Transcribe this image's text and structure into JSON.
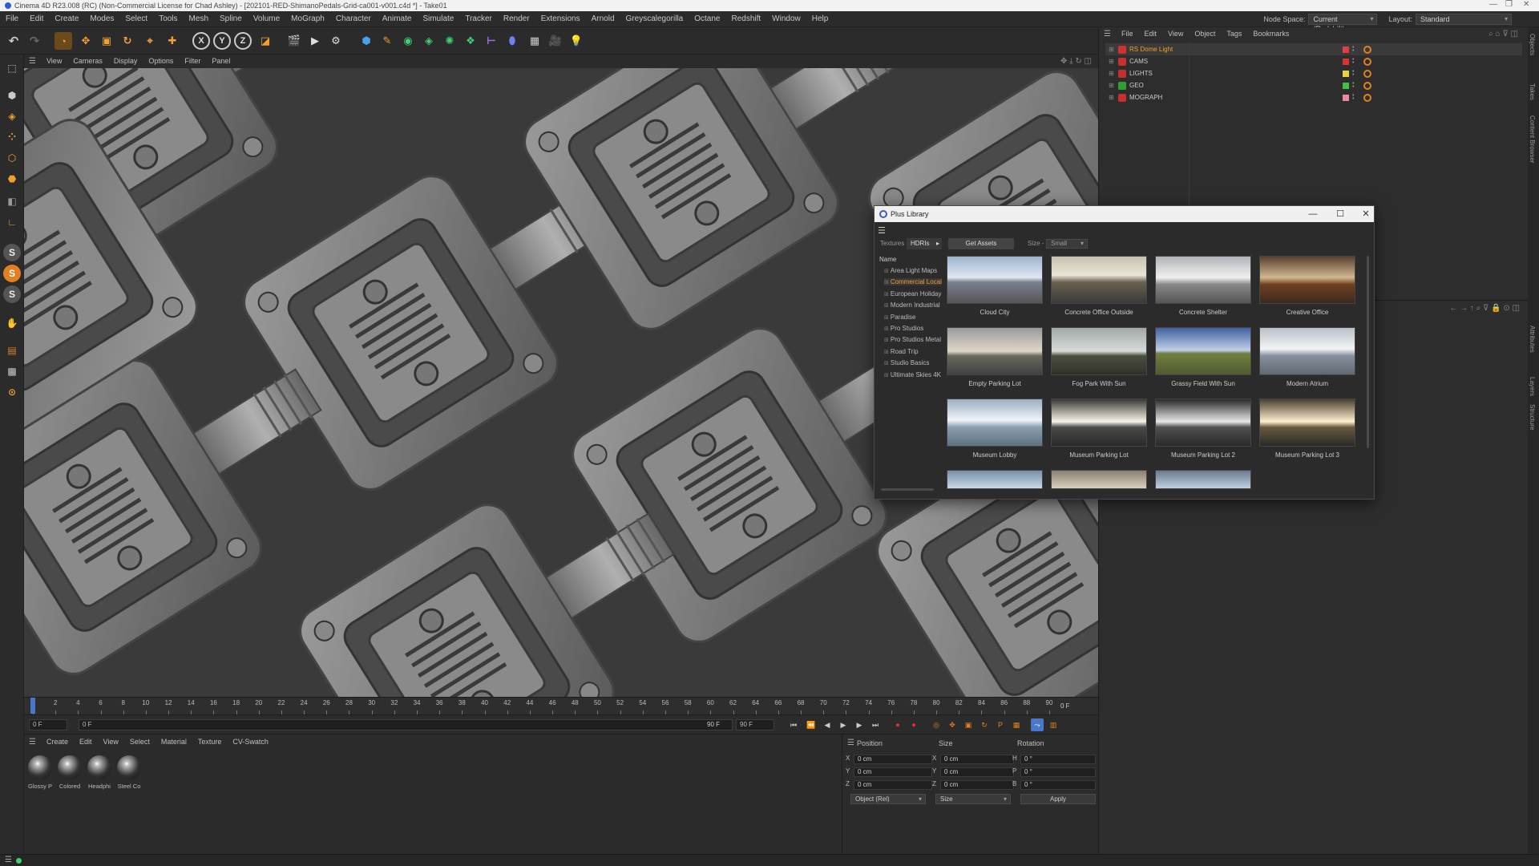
{
  "window_title": "Cinema 4D R23.008 (RC) (Non-Commercial License for Chad Ashley) - [202101-RED-ShimanoPedals-Grid-ca001-v001.c4d *] - Take01",
  "menu": [
    "File",
    "Edit",
    "Create",
    "Modes",
    "Select",
    "Tools",
    "Mesh",
    "Spline",
    "Volume",
    "MoGraph",
    "Character",
    "Animate",
    "Simulate",
    "Tracker",
    "Render",
    "Extensions",
    "Arnold",
    "Greyscalegorilla",
    "Octane",
    "Redshift",
    "Window",
    "Help"
  ],
  "node_space_label": "Node Space:",
  "node_space_value": "Current (Redshift)",
  "layout_label": "Layout:",
  "layout_value": "Standard",
  "viewport_menu": [
    "View",
    "Cameras",
    "Display",
    "Options",
    "Filter",
    "Panel"
  ],
  "timeline": {
    "ticks": [
      "0",
      "2",
      "4",
      "6",
      "8",
      "10",
      "12",
      "14",
      "16",
      "18",
      "20",
      "22",
      "24",
      "26",
      "28",
      "30",
      "32",
      "34",
      "36",
      "38",
      "40",
      "42",
      "44",
      "46",
      "48",
      "50",
      "52",
      "54",
      "56",
      "58",
      "60",
      "62",
      "64",
      "66",
      "68",
      "70",
      "72",
      "74",
      "76",
      "78",
      "80",
      "82",
      "84",
      "86",
      "88",
      "90"
    ],
    "current_frame": "0 F",
    "start_field": "0 F",
    "start2_field": "0 F",
    "end_field": "90 F",
    "end2_field": "90 F"
  },
  "material_menu": [
    "Create",
    "Edit",
    "View",
    "Select",
    "Material",
    "Texture",
    "CV-Swatch"
  ],
  "materials": [
    "Glossy P",
    "Colored",
    "Headphi",
    "Steel Co"
  ],
  "coords": {
    "headers": [
      "Position",
      "Size",
      "Rotation"
    ],
    "rows": [
      {
        "axis": "X",
        "pos": "0 cm",
        "saxis": "X",
        "size": "0 cm",
        "raxis": "H",
        "rot": "0 °"
      },
      {
        "axis": "Y",
        "pos": "0 cm",
        "saxis": "Y",
        "size": "0 cm",
        "raxis": "P",
        "rot": "0 °"
      },
      {
        "axis": "Z",
        "pos": "0 cm",
        "saxis": "Z",
        "size": "0 cm",
        "raxis": "B",
        "rot": "0 °"
      }
    ],
    "mode_select": "Object (Rel)",
    "size_select": "Size",
    "apply": "Apply"
  },
  "object_menu": [
    "File",
    "Edit",
    "View",
    "Object",
    "Tags",
    "Bookmarks"
  ],
  "objects": [
    {
      "name": "RS Dome Light",
      "color": "#e04040",
      "icon": "#d03030",
      "selected": true
    },
    {
      "name": "CAMS",
      "color": "#e03030",
      "icon": "#c83030",
      "selected": false
    },
    {
      "name": "LIGHTS",
      "color": "#e8d040",
      "icon": "#c83030",
      "selected": false
    },
    {
      "name": "GEO",
      "color": "#40c040",
      "icon": "#30a030",
      "selected": false
    },
    {
      "name": "MOGRAPH",
      "color": "#e88aa0",
      "icon": "#c83030",
      "selected": false
    }
  ],
  "side_tabs": [
    "Objects",
    "Takes",
    "Content Browser",
    "Attributes",
    "Layers",
    "Structure"
  ],
  "library": {
    "title": "Plus Library",
    "tabs": [
      "Textures",
      "HDRIs"
    ],
    "get_assets": "Get Assets",
    "size_label": "Size -",
    "size_value": "Small",
    "name_header": "Name",
    "categories": [
      "Area Light Maps",
      "Commercial Local",
      "European Holiday",
      "Modern Industrial",
      "Paradise",
      "Pro Studios",
      "Pro Studios Metal",
      "Road Trip",
      "Studio Basics",
      "Ultimate Skies 4K"
    ],
    "active_category": 1,
    "thumbs": [
      "Cloud City",
      "Concrete Office Outside",
      "Concrete Shelter",
      "Creative Office",
      "Empty Parking Lot",
      "Fog Park With Sun",
      "Grassy Field With Sun",
      "Modern Atrium",
      "Museum Lobby",
      "Museum Parking Lot",
      "Museum Parking Lot 2",
      "Museum Parking Lot 3",
      "",
      "",
      ""
    ]
  },
  "colors": {
    "accent": "#e08020",
    "ui_bg": "#2b2b2b",
    "viewport": "#3a3a3a"
  }
}
